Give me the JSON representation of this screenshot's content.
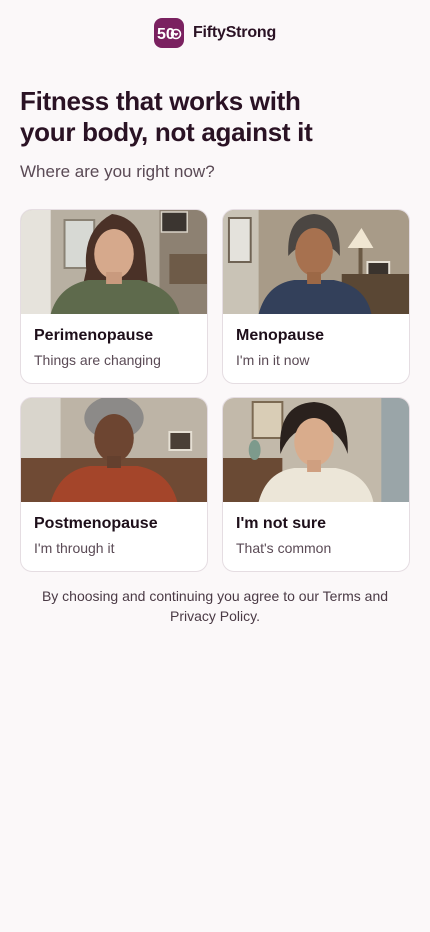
{
  "app": {
    "name": "FiftyStrong",
    "logo_mark": "50",
    "brand_color": "#7a2160"
  },
  "hero": {
    "headline": "Fitness that works with your body, not against it",
    "question": "Where are you right now?"
  },
  "options": [
    {
      "title": "Perimenopause",
      "subtitle": "Things are changing"
    },
    {
      "title": "Menopause",
      "subtitle": "I'm in it now"
    },
    {
      "title": "Postmenopause",
      "subtitle": "I'm through it"
    },
    {
      "title": "I'm not sure",
      "subtitle": "That's common"
    }
  ],
  "legal": {
    "prefix": "By choosing and continuing you agree to our ",
    "terms": "Terms",
    "joiner": " and ",
    "privacy": "Privacy Policy",
    "suffix": "."
  }
}
